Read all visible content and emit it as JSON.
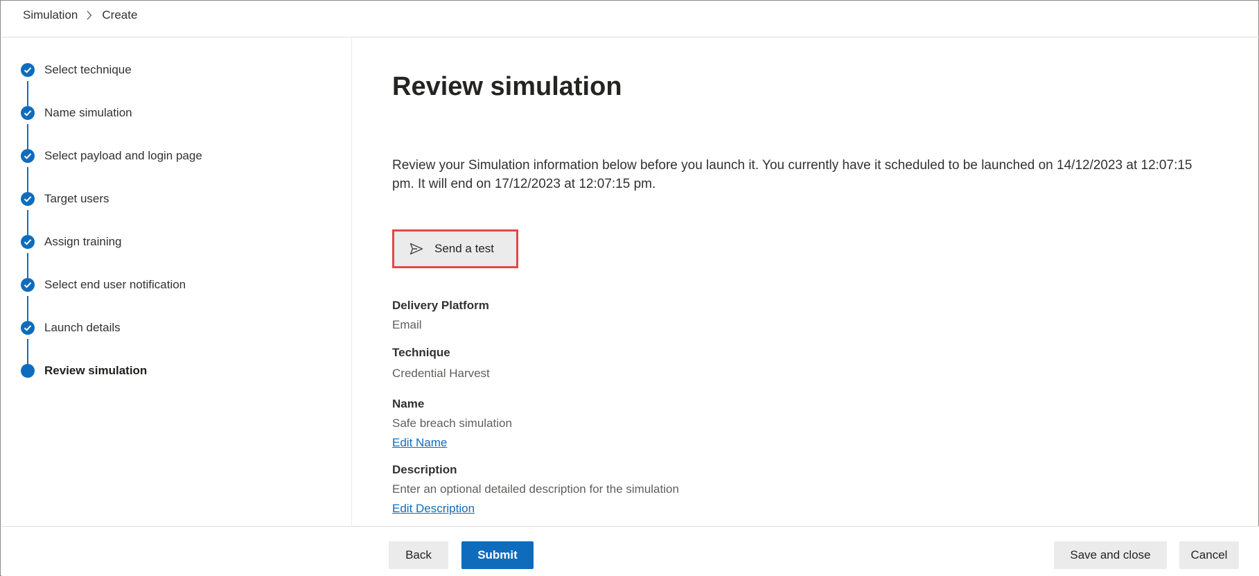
{
  "breadcrumb": {
    "items": [
      "Simulation",
      "Create"
    ]
  },
  "steps": [
    {
      "label": "Select technique",
      "status": "completed"
    },
    {
      "label": "Name simulation",
      "status": "completed"
    },
    {
      "label": "Select payload and login page",
      "status": "completed"
    },
    {
      "label": "Target users",
      "status": "completed"
    },
    {
      "label": "Assign training",
      "status": "completed"
    },
    {
      "label": "Select end user notification",
      "status": "completed"
    },
    {
      "label": "Launch details",
      "status": "completed"
    },
    {
      "label": "Review simulation",
      "status": "current"
    }
  ],
  "main": {
    "title": "Review simulation",
    "intro": "Review your Simulation information below before you launch it. You currently have it scheduled to be launched on 14/12/2023 at 12:07:15 pm. It will end on 17/12/2023 at 12:07:15 pm.",
    "send_test_label": "Send a test",
    "fields": {
      "delivery_platform": {
        "label": "Delivery Platform",
        "value": "Email"
      },
      "technique": {
        "label": "Technique",
        "value": "Credential Harvest"
      },
      "name": {
        "label": "Name",
        "value": "Safe breach simulation",
        "edit_link": "Edit Name"
      },
      "description": {
        "label": "Description",
        "value": "Enter an optional detailed description for the simulation",
        "edit_link": "Edit Description"
      }
    }
  },
  "footer": {
    "back_label": "Back",
    "submit_label": "Submit",
    "save_close_label": "Save and close",
    "cancel_label": "Cancel"
  },
  "colors": {
    "accent": "#0f6cbd",
    "highlight_border": "#e0474a",
    "button_secondary": "#ebebeb"
  },
  "icons": {
    "step_completed": "checkmark-icon",
    "step_current": "filled-circle-icon",
    "send": "send-icon",
    "breadcrumb_separator": "chevron-right-icon"
  }
}
